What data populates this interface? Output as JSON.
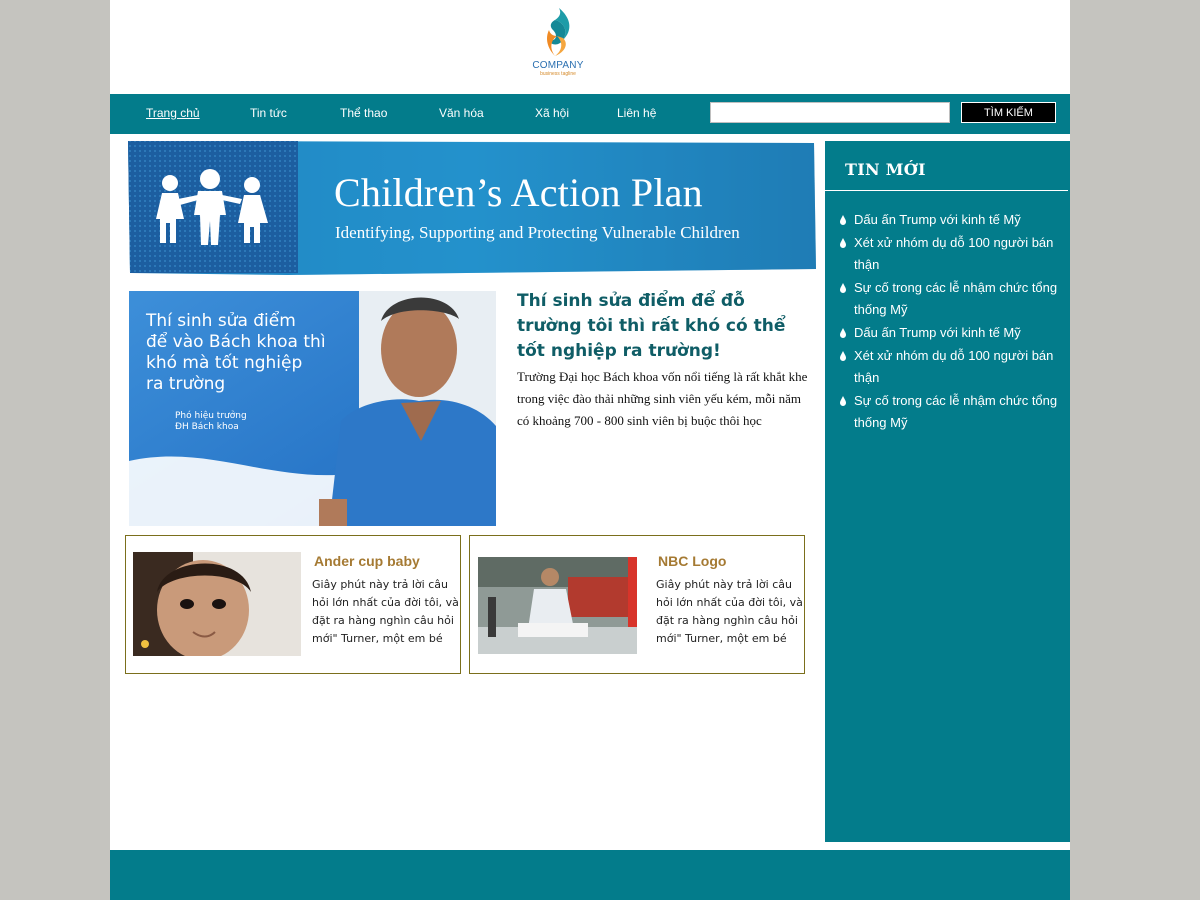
{
  "logo": {
    "name": "COMPANY",
    "tagline": "business tagline"
  },
  "nav": {
    "items": [
      "Trang chủ",
      "Tin tức",
      "Thể thao",
      "Văn hóa",
      "Xã hội",
      "Liên hệ"
    ],
    "search_value": "",
    "search_button": "TÌM KIẾM"
  },
  "banner": {
    "title": "Children’s Action Plan",
    "subtitle": "Identifying, Supporting and Protecting Vulnerable Children"
  },
  "feature": {
    "image_text": "Thí sinh sửa điểm\nđể vào Bách khoa thì\nkhó mà tốt nghiệp\nra trường",
    "image_caption": "Phó hiệu trưởng\nĐH Bách khoa",
    "title": "Thí sinh sửa điểm để đỗ trường tôi thì rất khó có thể tốt nghiệp ra trường!",
    "description": "Trường Đại học Bách khoa vốn nổi tiếng là rất khắt khe trong việc đào thải những sinh viên yếu kém, mỗi năm có khoảng 700 - 800 sinh viên bị buộc thôi học"
  },
  "cards": [
    {
      "title": "Ander cup baby",
      "text": "Giây phút này trả lời câu hỏi lớn nhất của đời tôi, và đặt ra hàng nghìn câu hỏi mới\" Turner, một em bé"
    },
    {
      "title": "NBC Logo",
      "text": "Giây phút này trả lời câu hỏi lớn nhất của đời tôi, và đặt ra hàng nghìn câu hỏi mới\" Turner, một em bé"
    }
  ],
  "sidebar": {
    "heading": "TIN MỚI",
    "items": [
      "Dấu ấn Trump với kinh tế Mỹ",
      "Xét xử nhóm dụ dỗ 100 người bán thận",
      "Sự cố trong các lễ nhậm chức tổng thống Mỹ",
      "Dấu ấn Trump với kinh tế Mỹ",
      "Xét xử nhóm dụ dỗ 100 người bán thận",
      "Sự cố trong các lễ nhậm chức tổng thống Mỹ"
    ]
  },
  "colors": {
    "teal": "#037c8b",
    "page_bg": "#c5c4bf",
    "feature_title": "#0f5d66",
    "card_title": "#a57a33",
    "card_border": "#7b6f1c"
  },
  "icons": [
    "company-logo-icon",
    "droplet-bullet-icon",
    "children-silhouette-icon"
  ]
}
